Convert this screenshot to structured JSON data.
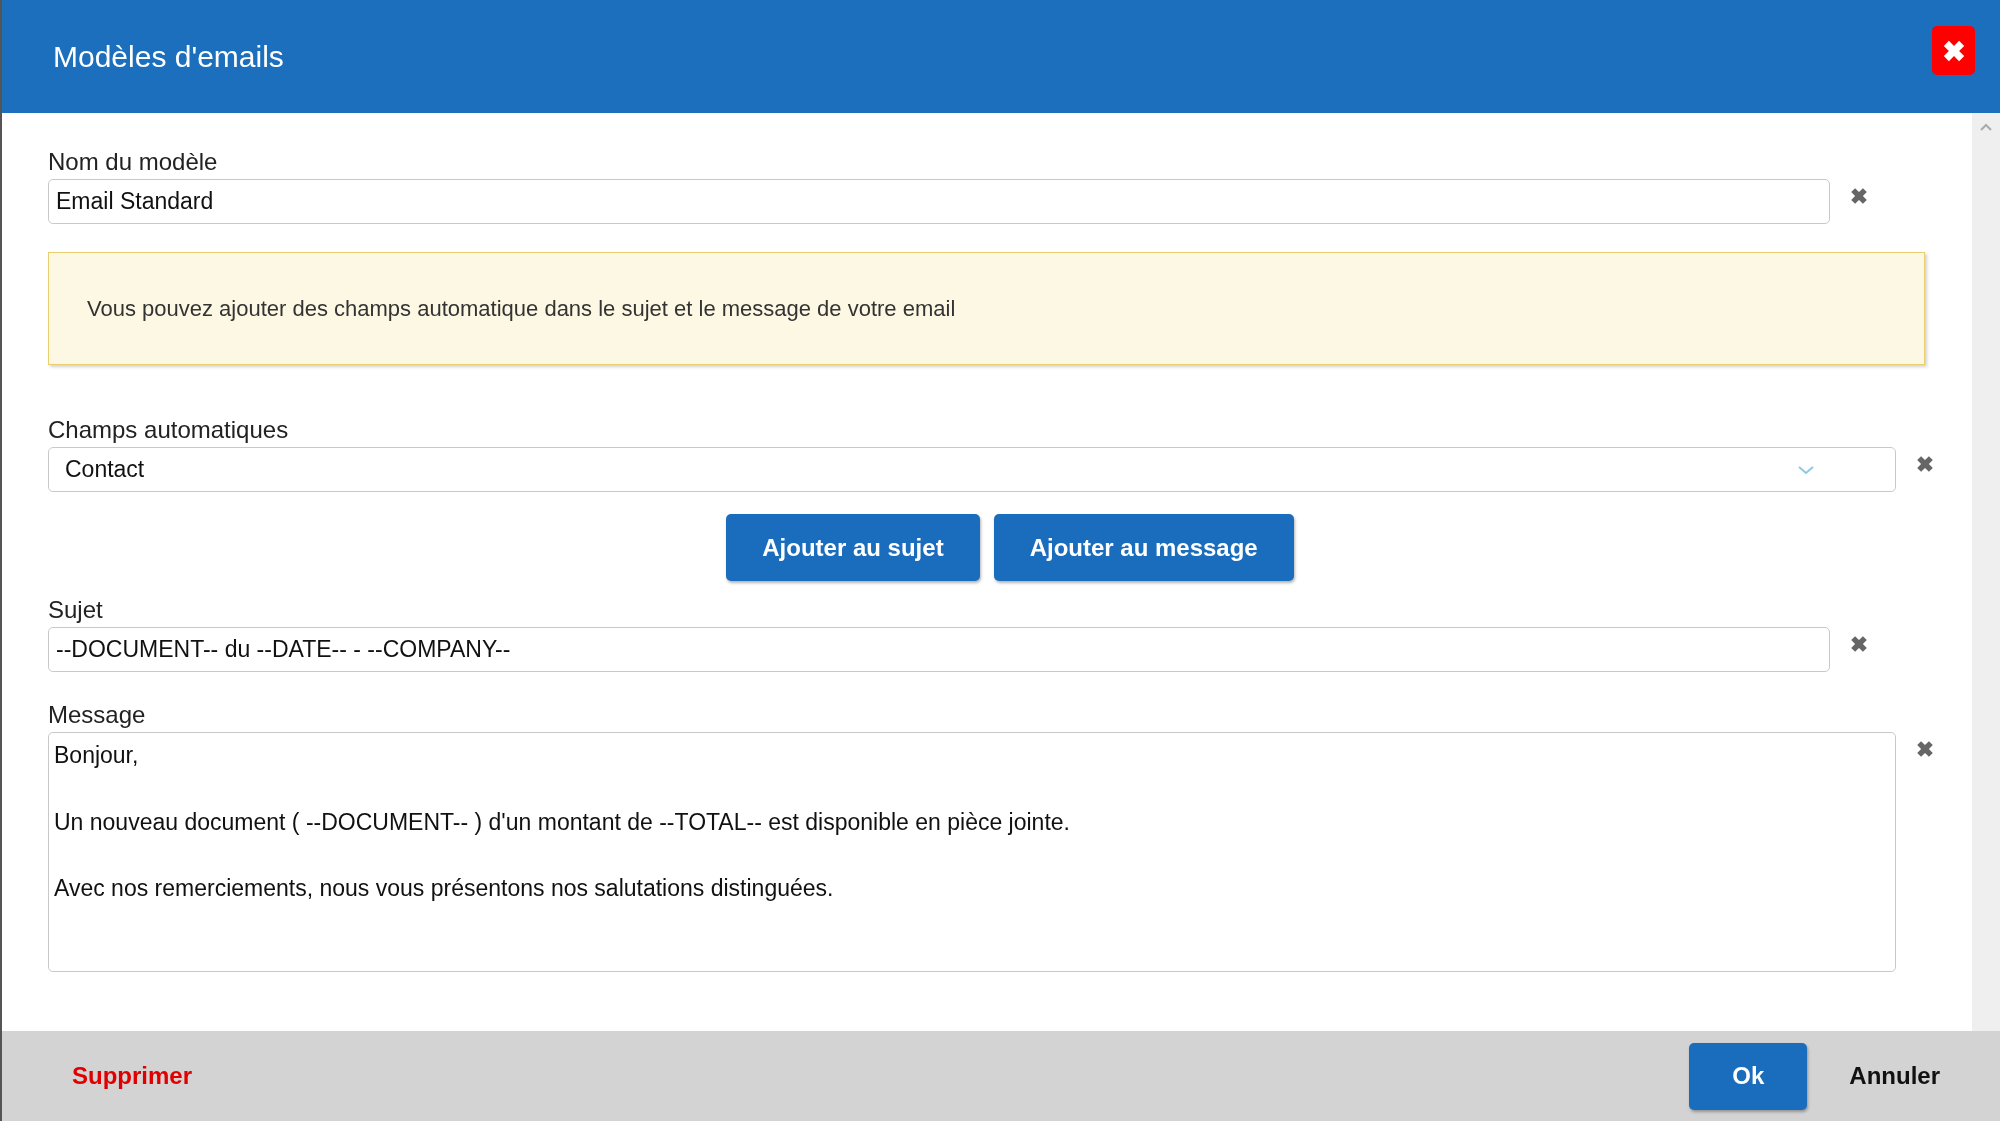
{
  "dialog": {
    "title": "Modèles d'emails"
  },
  "template_name": {
    "label": "Nom du modèle",
    "value": "Email Standard"
  },
  "notice": {
    "text": "Vous pouvez ajouter des champs automatique dans le sujet et le message de votre email"
  },
  "auto_fields": {
    "label": "Champs automatiques",
    "value": "Contact"
  },
  "insert_buttons": [
    {
      "label": "Ajouter au sujet"
    },
    {
      "label": "Ajouter au message"
    }
  ],
  "subject": {
    "label": "Sujet",
    "value": "--DOCUMENT-- du --DATE-- - --COMPANY--"
  },
  "message": {
    "label": "Message",
    "paragraphs": [
      "Bonjour,",
      "Un nouveau document ( --DOCUMENT-- ) d'un montant de --TOTAL-- est disponible en pièce jointe.",
      "Avec nos remerciements, nous vous présentons nos salutations distinguées."
    ]
  },
  "footer": {
    "delete": "Supprimer",
    "ok": "Ok",
    "cancel": "Annuler"
  }
}
